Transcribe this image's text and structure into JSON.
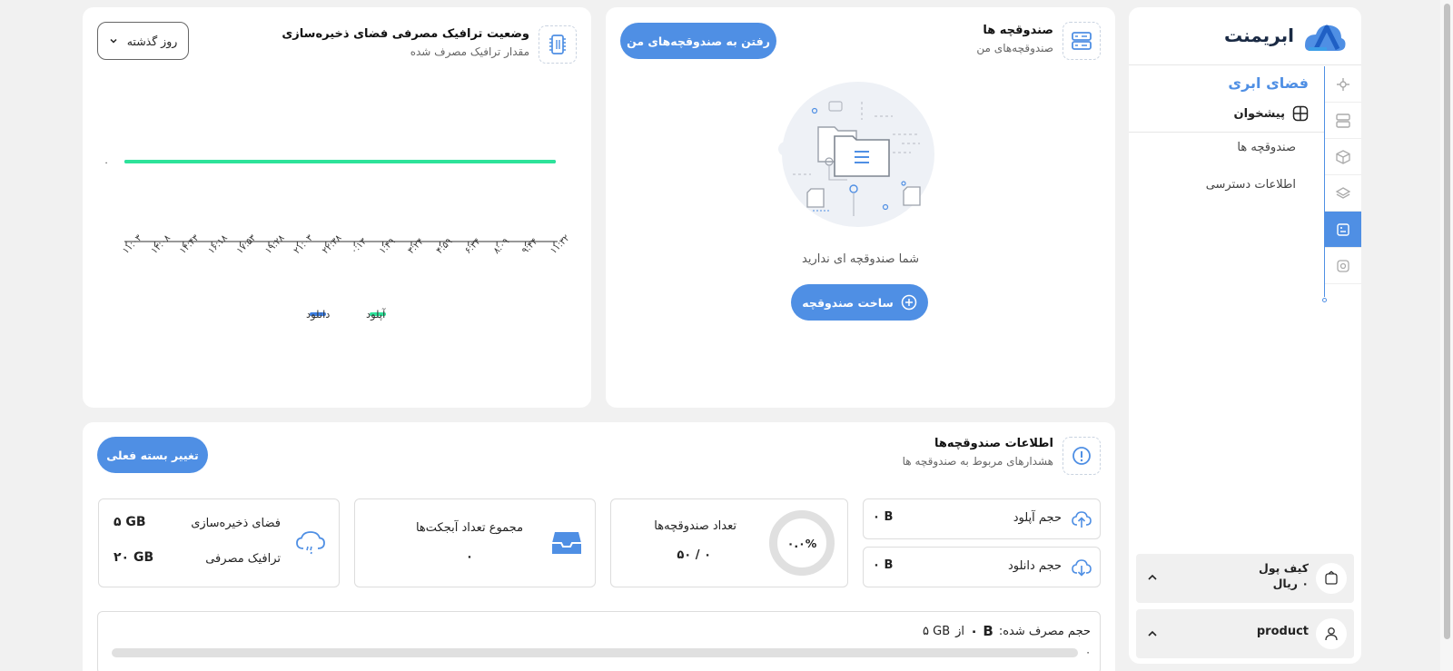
{
  "brand": {
    "name": "ابریمنت"
  },
  "sidebar": {
    "section_title": "فضای ابری",
    "dashboard_label": "پیشخوان",
    "links": [
      "صندوقچه ها",
      "اطلاعات دسترسی"
    ],
    "wallet": {
      "label": "کیف پول",
      "amount": "۰ ریال"
    },
    "user": {
      "name": "product"
    },
    "accent_color": "#4f8fe4"
  },
  "buckets_card": {
    "title": "صندوقچه ها",
    "subtitle": "صندوقچه‌های من",
    "go_button": "رفتن به صندوقچه‌های من",
    "empty_text": "شما صندوقچه ای ندارید",
    "create_button": "ساخت صندوقچه"
  },
  "traffic_card": {
    "title": "وضعیت ترافیک مصرفی فضای ذخیره‌سازی",
    "subtitle": "مقدار ترافیک مصرف شده",
    "range_select": "روز گذشته"
  },
  "chart_data": {
    "type": "line",
    "title": "",
    "x": [
      "۱۱:۰۳",
      "۱۳:۰۸",
      "۱۴:۴۳",
      "۱۶:۱۸",
      "۱۷:۵۳",
      "۱۹:۲۸",
      "۲۱:۰۳",
      "۲۲:۳۸",
      "۰:۱۳",
      "۱:۴۹",
      "۳:۲۴",
      "۴:۵۹",
      "۶:۳۴",
      "۸:۰۹",
      "۹:۴۴",
      "۱۱:۳۲"
    ],
    "series": [
      {
        "name": "آپلود",
        "color": "#2de39a",
        "values": [
          0,
          0,
          0,
          0,
          0,
          0,
          0,
          0,
          0,
          0,
          0,
          0,
          0,
          0,
          0,
          0
        ]
      },
      {
        "name": "دانلود",
        "color": "#3b7de2",
        "values": [
          0,
          0,
          0,
          0,
          0,
          0,
          0,
          0,
          0,
          0,
          0,
          0,
          0,
          0,
          0,
          0
        ]
      }
    ],
    "y_ticks": [
      "۰"
    ],
    "xlabel": "",
    "ylabel": "",
    "grid": false,
    "legend": "bottom-center"
  },
  "info_card": {
    "title": "اطلاعات صندوقچه‌ها",
    "subtitle": "هشدارهای مربوط به صندوقچه ها",
    "change_plan_button": "تغییر بسته فعلی",
    "upload_label": "حجم آپلود",
    "upload_value": "۰ B",
    "download_label": "حجم دانلود",
    "download_value": "۰ B",
    "buckets_count_label": "تعداد صندوقچه‌ها",
    "buckets_count_value": "۰ / ۵۰",
    "buckets_percent": "۰.۰%",
    "objects_label": "مجموع تعداد آبجکت‌ها",
    "objects_value": "۰",
    "storage_label": "فضای ذخیره‌سازی",
    "storage_value": "۵ GB",
    "traffic_label": "ترافیک مصرفی",
    "traffic_value": "۲۰ GB",
    "usage_prefix": "حجم مصرف شده:",
    "usage_value": "۰ B",
    "usage_of": "از",
    "usage_total": "۵ GB",
    "usage_percent": "۰"
  }
}
